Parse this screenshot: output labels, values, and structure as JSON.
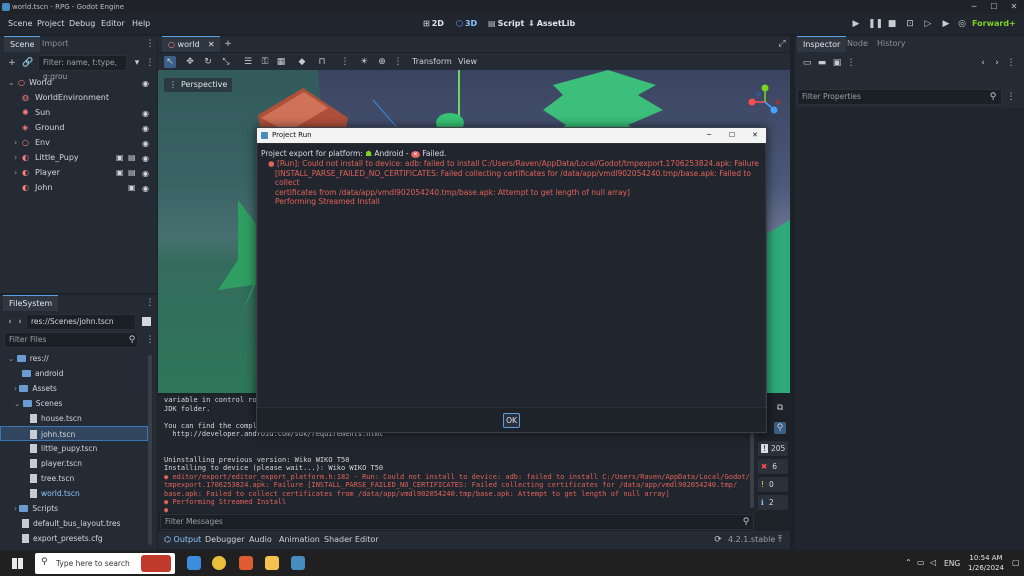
{
  "window": {
    "title": "world.tscn - RPG - Godot Engine"
  },
  "menu": [
    "Scene",
    "Project",
    "Debug",
    "Editor",
    "Help"
  ],
  "workspaces": {
    "w2d": "2D",
    "w3d": "3D",
    "script": "Script",
    "assetlib": "AssetLib"
  },
  "renderer": "Forward+",
  "scene_dock": {
    "tabs": [
      "Scene",
      "Import"
    ],
    "filter_placeholder": "Filter: name, t:type, g:grou",
    "nodes": [
      {
        "name": "World",
        "icon": "node3d-icon"
      },
      {
        "name": "WorldEnvironment",
        "icon": "world-environment-icon"
      },
      {
        "name": "Sun",
        "icon": "directional-light-icon"
      },
      {
        "name": "Ground",
        "icon": "mesh-instance-icon"
      },
      {
        "name": "Env",
        "icon": "node3d-icon"
      },
      {
        "name": "Little_Pupy",
        "icon": "scene-instance-icon"
      },
      {
        "name": "Player",
        "icon": "scene-instance-icon"
      },
      {
        "name": "John",
        "icon": "scene-instance-icon"
      }
    ]
  },
  "filesystem": {
    "title": "FileSystem",
    "path": "res://Scenes/john.tscn",
    "filter_placeholder": "Filter Files",
    "items": [
      "res://",
      "android",
      "Assets",
      "Scenes",
      "house.tscn",
      "john.tscn",
      "little_pupy.tscn",
      "player.tscn",
      "tree.tscn",
      "world.tscn",
      "Scripts",
      "default_bus_layout.tres",
      "export_presets.cfg"
    ]
  },
  "editor_tab": "world",
  "toolbar": {
    "transform": "Transform",
    "view": "View"
  },
  "viewport": {
    "perspective": "Perspective"
  },
  "dialog": {
    "title": "Project Run",
    "line1_prefix": "Project export for platform:",
    "platform": "Android",
    "dash": "-",
    "status": "Failed.",
    "errors": [
      "[Run]: Could not install to device: adb: failed to install C:/Users/Raven/AppData/Local/Godot/tmpexport.1706253824.apk: Failure",
      "[INSTALL_PARSE_FAILED_NO_CERTIFICATES: Failed collecting certificates for /data/app/vmdl902054240.tmp/base.apk: Failed to collect",
      "certificates from /data/app/vmdl902054240.tmp/base.apk: Attempt to get length of null array]",
      "Performing Streamed Install"
    ],
    "ok": "OK"
  },
  "output": {
    "lines": [
      "variable in control ro",
      "JDK folder.",
      "",
      "You can find the compl",
      "  http://developer.android.com/sdk/requirements.html",
      "",
      "",
      "Uninstalling previous version: Wiko WIKO T50",
      "Installing to device (please wait...): Wiko WIKO T50"
    ],
    "error_lines": [
      "editor/export/editor_export_platform.h:182 - Run: Could not install to device: adb: failed to install C:/Users/Raven/AppData/Local/Godot/",
      "tmpexport.1706253824.apk: Failure [INSTALL_PARSE_FAILED_NO_CERTIFICATES: Failed collecting certificates for /data/app/vmdl902054240.tmp/",
      "base.apk: Failed to collect certificates from /data/app/vmdl902054240.tmp/base.apk: Attempt to get length of null array]",
      "Performing Streamed Install"
    ],
    "filter_placeholder": "Filter Messages",
    "counts": {
      "messages": "205",
      "errors": "6",
      "warnings": "0",
      "info": "2"
    }
  },
  "bottom_tabs": [
    "Output",
    "Debugger",
    "Audio",
    "Animation",
    "Shader Editor"
  ],
  "version": "4.2.1.stable",
  "inspector": {
    "tabs": [
      "Inspector",
      "Node",
      "History"
    ],
    "filter_placeholder": "Filter Properties"
  },
  "taskbar": {
    "search_placeholder": "Type here to search",
    "lang": "ENG",
    "time": "10:54 AM",
    "date": "1/26/2024"
  }
}
